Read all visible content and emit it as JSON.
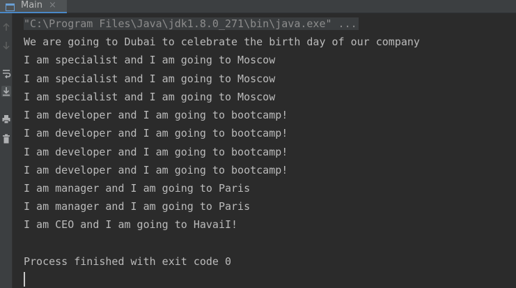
{
  "tab": {
    "label": "Main",
    "icon": "console-window-icon",
    "close_icon": "close-icon"
  },
  "toolbar": {
    "icons": [
      "up-arrow-icon",
      "down-arrow-icon",
      "soft-wrap-icon",
      "scroll-to-end-icon",
      "print-icon",
      "trash-icon"
    ]
  },
  "console": {
    "command": "\"C:\\Program Files\\Java\\jdk1.8.0_271\\bin\\java.exe\" ...",
    "lines": [
      "We are going to Dubai to celebrate the birth day of our company",
      "I am specialist and I am going to Moscow",
      "I am specialist and I am going to Moscow",
      "I am specialist and I am going to Moscow",
      "I am developer and I am going to bootcamp!",
      "I am developer and I am going to bootcamp!",
      "I am developer and I am going to bootcamp!",
      "I am developer and I am going to bootcamp!",
      "I am manager and I am going to Paris",
      "I am manager and I am going to Paris",
      "I am CEO and I am going to HavaiI!",
      "",
      "Process finished with exit code 0"
    ]
  },
  "colors": {
    "background": "#2b2b2b",
    "text": "#bbbbbb",
    "command_text": "#8c8c8c",
    "tab_underline": "#4a88c7"
  }
}
